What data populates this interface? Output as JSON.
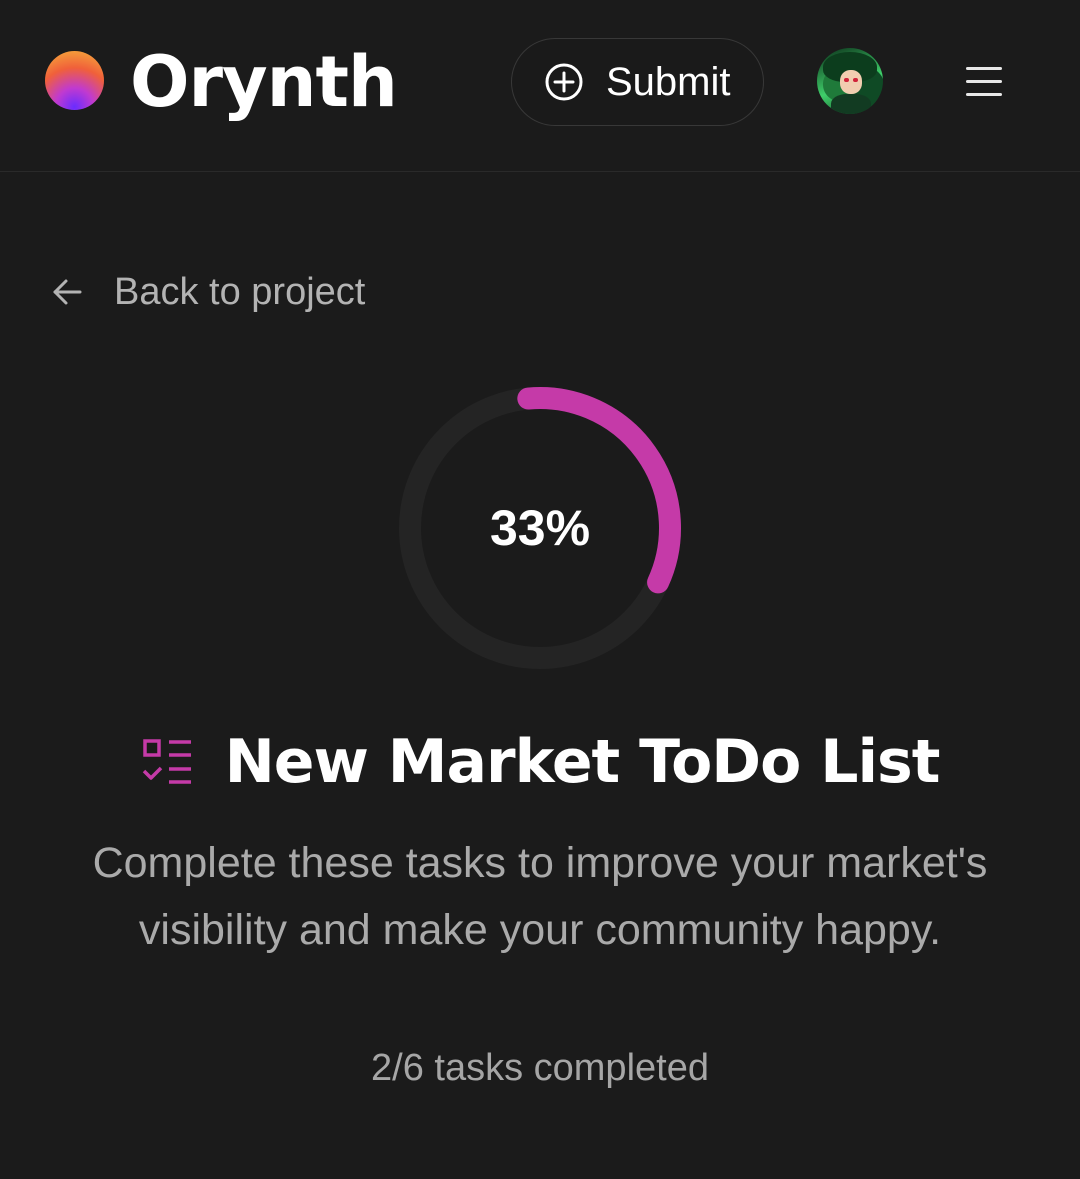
{
  "header": {
    "brand": "Orynth",
    "submit_label": "Submit"
  },
  "back_link": {
    "label": "Back to project"
  },
  "progress": {
    "percent_label": "33%",
    "fraction": 0.333,
    "accent_color": "#c53aa8",
    "track_color": "#242424"
  },
  "todo": {
    "title": "New Market ToDo List",
    "description": "Complete these tasks to improve your market's visibility and make your community happy.",
    "count_label": "2/6 tasks completed"
  },
  "icons": {
    "submit": "plus-circle-icon",
    "back": "arrow-left-icon",
    "menu": "hamburger-menu-icon",
    "list": "checklist-icon"
  }
}
